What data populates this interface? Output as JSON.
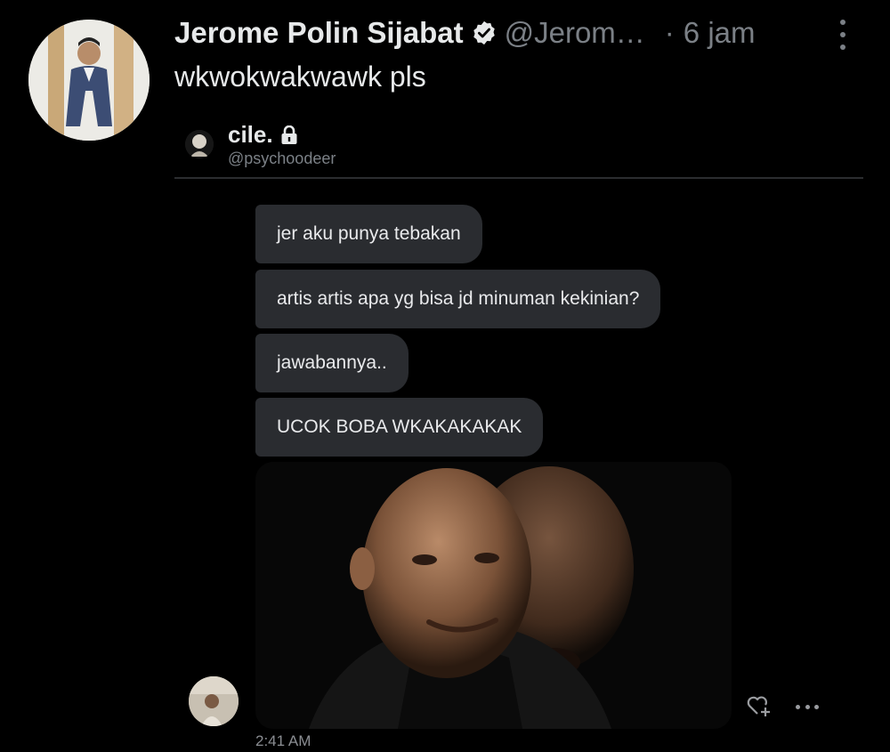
{
  "tweet": {
    "author_name": "Jerome Polin Sijabat",
    "handle": "@Jerom…",
    "separator": "·",
    "time": "6 jam",
    "text": "wkwokwakwawk pls"
  },
  "quoted": {
    "name": "cile.",
    "handle": "@psychoodeer"
  },
  "chat": {
    "messages": [
      "jer aku punya tebakan",
      "artis artis apa yg bisa jd minuman kekinian?",
      "jawabannya..",
      "UCOK BOBA WKAKAKAKAK"
    ],
    "timestamp": "2:41 AM"
  },
  "icons": {
    "verified": "verified-badge-icon",
    "lock": "lock-icon",
    "menu": "more-vertical-icon",
    "react": "heart-plus-icon",
    "more": "more-horizontal-icon"
  },
  "colors": {
    "background": "#000000",
    "bubble": "#2a2c30",
    "muted_text": "#7b8086"
  }
}
